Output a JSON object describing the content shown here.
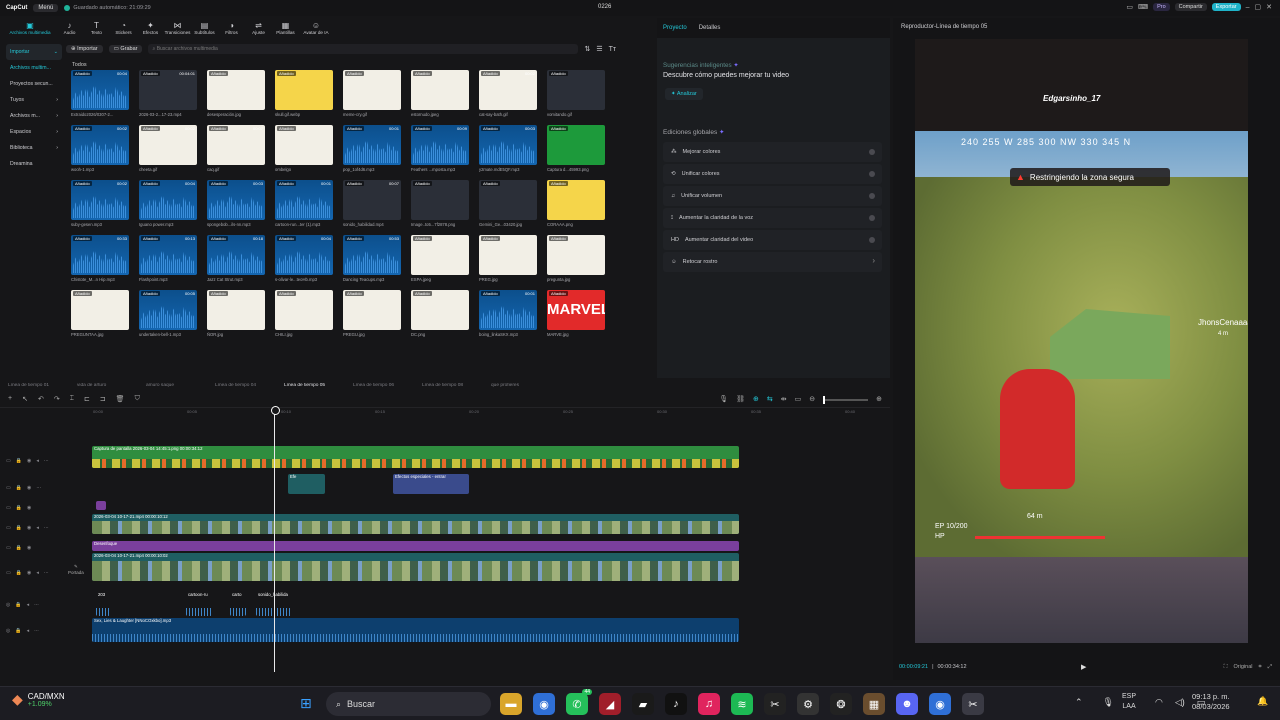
{
  "titlebar": {
    "logo": "CapCut",
    "menu": "Menú",
    "autosave": "Guardado automático: 21:09:29",
    "project": "0226",
    "pro": "Pro",
    "share": "Compartir",
    "export": "Exportar"
  },
  "toolbar": [
    {
      "label": "Archivos multimedia",
      "icon": "media-icon"
    },
    {
      "label": "Audio",
      "icon": "audio-icon"
    },
    {
      "label": "Texto",
      "icon": "text-icon"
    },
    {
      "label": "Stickers",
      "icon": "sticker-icon"
    },
    {
      "label": "Efectos",
      "icon": "effects-icon"
    },
    {
      "label": "Transiciones",
      "icon": "transitions-icon"
    },
    {
      "label": "Subtítulos",
      "icon": "subtitles-icon"
    },
    {
      "label": "Filtros",
      "icon": "filters-icon"
    },
    {
      "label": "Ajuste",
      "icon": "adjust-icon"
    },
    {
      "label": "Plantillas",
      "icon": "templates-icon"
    },
    {
      "label": "Avatar de IA",
      "icon": "ai-avatar-icon"
    }
  ],
  "sidebar": [
    {
      "label": "Importar"
    },
    {
      "label": "Archivos multim..."
    },
    {
      "label": "Proyectos secun..."
    },
    {
      "label": "Tuyos"
    },
    {
      "label": "Archivos m..."
    },
    {
      "label": "Espacios"
    },
    {
      "label": "Biblioteca"
    },
    {
      "label": "Dreamina"
    }
  ],
  "media": {
    "import": "Importar",
    "record": "Grabar",
    "search_placeholder": "Buscar archivos multimedia",
    "all": "Todos",
    "added": "Añadido",
    "items": [
      {
        "name": "Extraido2026/0307-2...",
        "type": "audio",
        "dur": "00:04"
      },
      {
        "name": "2026-03-2...17-23.mp4",
        "type": "dark",
        "dur": "00:04:01"
      },
      {
        "name": "desesperación.jpg",
        "type": "img",
        "dur": ""
      },
      {
        "name": "skull.gif.webp",
        "type": "yellow",
        "dur": ""
      },
      {
        "name": "meme-cry.gif",
        "type": "img",
        "dur": ""
      },
      {
        "name": "estornudo.jpeg",
        "type": "img",
        "dur": ""
      },
      {
        "name": "cat-say-bath.gif",
        "type": "img",
        "dur": "00:02"
      },
      {
        "name": "vomitando.gif",
        "type": "dark",
        "dur": ""
      },
      {
        "name": "wooh-1.mp3",
        "type": "audio",
        "dur": "00:02"
      },
      {
        "name": "cheeta.gif",
        "type": "img",
        "dur": "00:02"
      },
      {
        "name": "caq.gif",
        "type": "img",
        "dur": "00:07"
      },
      {
        "name": "ombelgo",
        "type": "img",
        "dur": ""
      },
      {
        "name": "pop_1of4d6.mp3",
        "type": "audio",
        "dur": "00:01"
      },
      {
        "name": "Feathers ...mposta.mp3",
        "type": "audio",
        "dur": "00:09"
      },
      {
        "name": "y2mate.mdE5QF.mp3",
        "type": "audio",
        "dur": "00:03"
      },
      {
        "name": "Captura d...45993.png",
        "type": "green",
        "dur": ""
      },
      {
        "name": "suby-gesen.mp3",
        "type": "audio",
        "dur": "00:02"
      },
      {
        "name": "Iguano power.mp3",
        "type": "audio",
        "dur": "00:04"
      },
      {
        "name": "spongebob...ils-nn.mp3",
        "type": "audio",
        "dur": "00:03"
      },
      {
        "name": "cartoon-run...ter (1).mp3",
        "type": "audio",
        "dur": "00:01"
      },
      {
        "name": "sonido_habilidad.mp4",
        "type": "dark",
        "dur": "00:07"
      },
      {
        "name": "Image..to5...7f2878.png",
        "type": "dark",
        "dur": ""
      },
      {
        "name": "Gemini_Ge...03420.jpg",
        "type": "dark",
        "dur": ""
      },
      {
        "name": "CORAAA.png",
        "type": "yellow",
        "dur": ""
      },
      {
        "name": "Chistote_M...n Hip.mp3",
        "type": "audio",
        "dur": "00:33"
      },
      {
        "name": "Flashpoint.mp3",
        "type": "audio",
        "dur": "00:13"
      },
      {
        "name": "Jazz Cat Strut.mp3",
        "type": "audio",
        "dur": "00:18"
      },
      {
        "name": "s-olivar-le...teoHb.mp3",
        "type": "audio",
        "dur": "00:04"
      },
      {
        "name": "Dancing Teacups.mp3",
        "type": "audio",
        "dur": "00:53"
      },
      {
        "name": "ESPA.jpeg",
        "type": "img",
        "dur": ""
      },
      {
        "name": "PREG.jpg",
        "type": "img",
        "dur": ""
      },
      {
        "name": "pregunta.jpg",
        "type": "img",
        "dur": ""
      },
      {
        "name": "PREGUNTAA.jpg",
        "type": "img",
        "dur": ""
      },
      {
        "name": "undertaken-bell-1.mp3",
        "type": "audio",
        "dur": "00:05"
      },
      {
        "name": "ÑOR.jpg",
        "type": "img",
        "dur": ""
      },
      {
        "name": "CHILI.jpg",
        "type": "img",
        "dur": ""
      },
      {
        "name": "PREGU.jpg",
        "type": "img",
        "dur": ""
      },
      {
        "name": "DC.png",
        "type": "img",
        "dur": ""
      },
      {
        "name": "boing_linkaSKX.mp3",
        "type": "audio",
        "dur": "00:01"
      },
      {
        "name": "MARVE.jpg",
        "type": "marvel",
        "dur": ""
      }
    ]
  },
  "props": {
    "tab1": "Proyecto",
    "tab2": "Detalles",
    "sug_title": "Sugerencias inteligentes",
    "sug_sub": "Descubre cómo puedes mejorar tu video",
    "analyze": "Analizar",
    "global": "Ediciones globales",
    "options": [
      {
        "label": "Mejorar colores",
        "arrow": false
      },
      {
        "label": "Unificar colores",
        "arrow": false
      },
      {
        "label": "Unificar volumen",
        "arrow": false
      },
      {
        "label": "Aumentar la claridad de la voz",
        "arrow": false
      },
      {
        "label": "Aumentar claridad del video",
        "arrow": false
      },
      {
        "label": "Retocar rostro",
        "arrow": true
      }
    ]
  },
  "player": {
    "title": "Reproductor-Línea de tiempo 05",
    "current": "00:00:09:21",
    "total": "00:00:34:12",
    "video": {
      "compass": "240  255  W  285  300  NW  330  345  N",
      "warning": "Restringiendo la zona segura",
      "enemy": "Edgarsinho_17",
      "rival": "JhonsCenaaaa",
      "hp": "HP",
      "ep": "EP 10/200",
      "dist": "4 m",
      "dist2": "64 m"
    },
    "ratio": "Original"
  },
  "timeline": {
    "tabs": [
      {
        "label": "Línea de tiempo 01",
        "on": false
      },
      {
        "label": "vida de arturo",
        "on": false
      },
      {
        "label": "amuro saque",
        "on": false
      },
      {
        "label": "Línea de tiempo 04",
        "on": false
      },
      {
        "label": "Línea de tiempo 05",
        "on": true
      },
      {
        "label": "Línea de tiempo 06",
        "on": false
      },
      {
        "label": "Línea de tiempo 08",
        "on": false
      },
      {
        "label": "que profieres",
        "on": false
      }
    ],
    "ruler": [
      "00:00",
      "00:05",
      "00:10",
      "00:15",
      "00:20",
      "00:25",
      "00:30",
      "00:35",
      "00:40"
    ],
    "cover": "Portada",
    "clips": {
      "screenshot": "Captura de pantalla 2026-03-04 14:45:1.png  00:00:34:12",
      "fx": "Efectos especiales - entrar",
      "stk": "Efe",
      "v1": "2026-03-04 10-17-21.mp4  00:00:10:12",
      "v1b": "2026-03-04 10-17-21.mp4  00:00:10:12",
      "blur": "Desenfoque",
      "v2": "2026-03-04 10-17-21.mp4  00:00:10:02",
      "a1": "203",
      "a2": "cartoon-ru",
      "a3": "carto",
      "a4": "sonido_habilida",
      "music": "Sex, Lies & Laughter [NNoCOxkbo].mp3"
    }
  },
  "taskbar": {
    "weather_t1": "CAD/MXN",
    "weather_t2": "+1.09%",
    "search": "Buscar",
    "badge": "44",
    "lang1": "ESP",
    "lang2": "LAA",
    "time": "09:13 p. m.",
    "date": "08/03/2026"
  }
}
